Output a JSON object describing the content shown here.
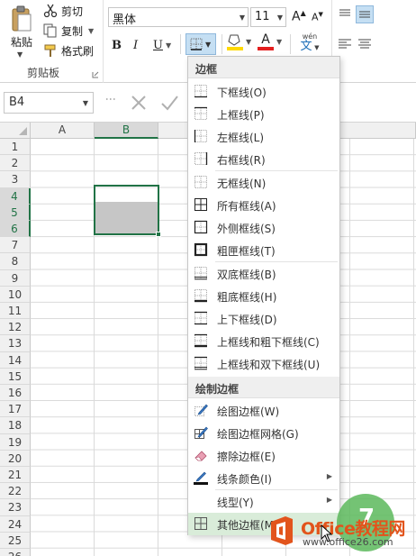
{
  "clipboard": {
    "paste_label": "粘贴",
    "cut_label": "剪切",
    "copy_label": "复制",
    "format_painter_label": "格式刷",
    "group_label": "剪贴板"
  },
  "font": {
    "name": "黑体",
    "size": "11",
    "grow_label": "A",
    "shrink_label": "A",
    "bold_label": "B",
    "italic_label": "I",
    "underline_label": "U",
    "font_color_label": "A",
    "phonetic_label": "wén",
    "phonetic_char": "文"
  },
  "formula_bar": {
    "name_box": "B4"
  },
  "grid": {
    "columns": [
      "A",
      "B"
    ],
    "rows": [
      "1",
      "2",
      "3",
      "4",
      "5",
      "6",
      "7",
      "8",
      "9",
      "10",
      "11",
      "12",
      "13",
      "14",
      "15",
      "16",
      "17",
      "18",
      "19",
      "20",
      "21",
      "22",
      "23",
      "24",
      "25",
      "26"
    ],
    "selected_column": "B",
    "selected_rows": [
      "4",
      "5",
      "6"
    ]
  },
  "menu": {
    "header_borders": "边框",
    "items_borders": [
      {
        "label": "下框线(O)",
        "icon": "bottom-border-icon"
      },
      {
        "label": "上框线(P)",
        "icon": "top-border-icon"
      },
      {
        "label": "左框线(L)",
        "icon": "left-border-icon"
      },
      {
        "label": "右框线(R)",
        "icon": "right-border-icon"
      },
      {
        "label": "无框线(N)",
        "icon": "no-border-icon"
      },
      {
        "label": "所有框线(A)",
        "icon": "all-borders-icon"
      },
      {
        "label": "外侧框线(S)",
        "icon": "outside-borders-icon"
      },
      {
        "label": "粗匣框线(T)",
        "icon": "thick-box-border-icon"
      },
      {
        "label": "双底框线(B)",
        "icon": "bottom-double-border-icon"
      },
      {
        "label": "粗底框线(H)",
        "icon": "thick-bottom-border-icon"
      },
      {
        "label": "上下框线(D)",
        "icon": "top-bottom-border-icon"
      },
      {
        "label": "上框线和粗下框线(C)",
        "icon": "top-thick-bottom-border-icon"
      },
      {
        "label": "上框线和双下框线(U)",
        "icon": "top-double-bottom-border-icon"
      }
    ],
    "header_draw": "绘制边框",
    "items_draw": [
      {
        "label": "绘图边框(W)",
        "icon": "draw-border-icon"
      },
      {
        "label": "绘图边框网格(G)",
        "icon": "draw-border-grid-icon"
      },
      {
        "label": "擦除边框(E)",
        "icon": "eraser-icon"
      },
      {
        "label": "线条颜色(I)",
        "icon": "line-color-icon"
      },
      {
        "label": "线型(Y)",
        "icon": ""
      },
      {
        "label": "其他边框(M)...",
        "icon": "more-borders-icon"
      }
    ]
  },
  "watermark": {
    "title": "Office教程网",
    "url": "www.office26.com",
    "number": "7"
  },
  "colors": {
    "excel_green": "#217346",
    "font_color_bar": "#e41e1e",
    "fill_color_bar": "#ffd900",
    "highlight": "#d9ecd9",
    "watermark_orange": "#e2541c"
  }
}
